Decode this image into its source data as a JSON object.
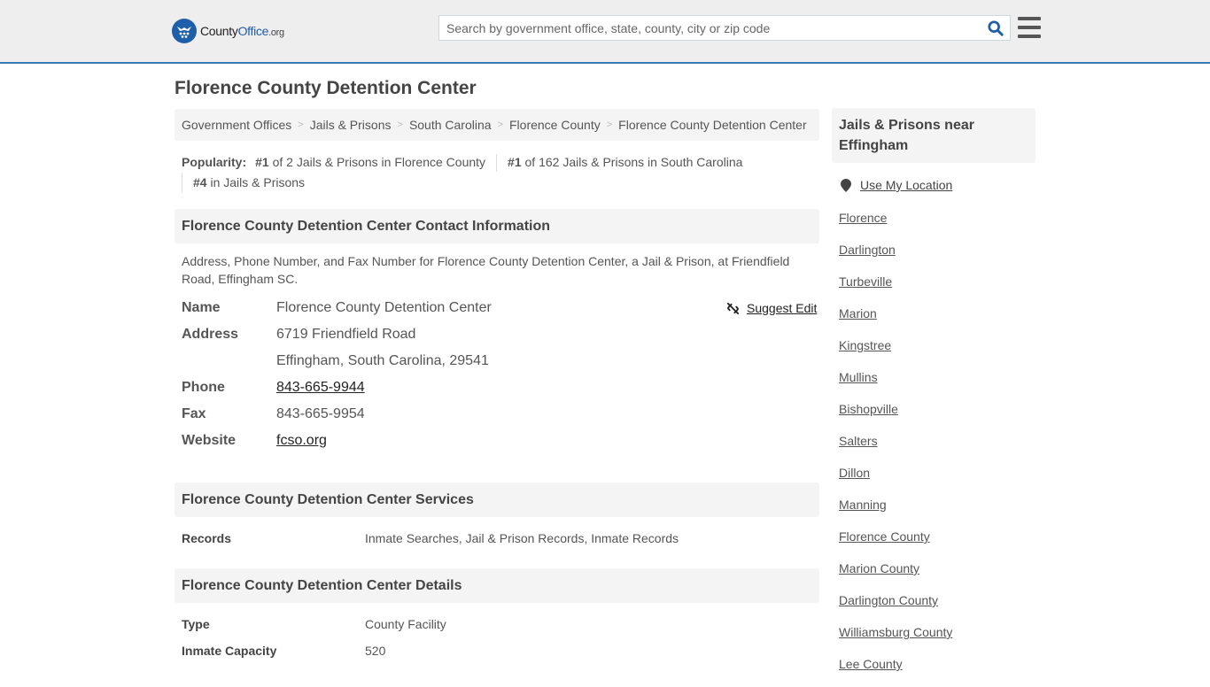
{
  "header": {
    "logo": {
      "part1": "County",
      "part2": "Office",
      "part3": ".org"
    },
    "search": {
      "placeholder": "Search by government office, state, county, city or zip code",
      "value": ""
    },
    "icons": {
      "search": "search-icon",
      "menu": "hamburger-menu-icon"
    }
  },
  "page": {
    "title": "Florence County Detention Center"
  },
  "breadcrumb": [
    "Government Offices",
    "Jails & Prisons",
    "South Carolina",
    "Florence County",
    "Florence County Detention Center"
  ],
  "popularity": {
    "label": "Popularity:",
    "items": [
      {
        "rank": "#1",
        "text": "of 2 Jails & Prisons in Florence County"
      },
      {
        "rank": "#1",
        "text": "of 162 Jails & Prisons in South Carolina"
      },
      {
        "rank": "#4",
        "text": "in Jails & Prisons"
      }
    ]
  },
  "contact": {
    "heading": "Florence County Detention Center Contact Information",
    "description": "Address, Phone Number, and Fax Number for Florence County Detention Center, a Jail & Prison, at Friendfield Road, Effingham SC.",
    "suggest_edit": "Suggest Edit",
    "rows": {
      "name": {
        "label": "Name",
        "value": "Florence County Detention Center"
      },
      "address": {
        "label": "Address",
        "line1": "6719 Friendfield Road",
        "line2": "Effingham, South Carolina, 29541"
      },
      "phone": {
        "label": "Phone",
        "value": "843-665-9944"
      },
      "fax": {
        "label": "Fax",
        "value": "843-665-9954"
      },
      "website": {
        "label": "Website",
        "value": "fcso.org"
      }
    }
  },
  "services": {
    "heading": "Florence County Detention Center Services",
    "rows": [
      {
        "label": "Records",
        "value": "Inmate Searches, Jail & Prison Records, Inmate Records"
      }
    ]
  },
  "details": {
    "heading": "Florence County Detention Center Details",
    "rows": [
      {
        "label": "Type",
        "value": "County Facility"
      },
      {
        "label": "Inmate Capacity",
        "value": "520"
      }
    ]
  },
  "sidebar": {
    "heading": "Jails & Prisons near Effingham",
    "use_location": "Use My Location",
    "links": [
      "Florence",
      "Darlington",
      "Turbeville",
      "Marion",
      "Kingstree",
      "Mullins",
      "Bishopville",
      "Salters",
      "Dillon",
      "Manning",
      "Florence County",
      "Marion County",
      "Darlington County",
      "Williamsburg County",
      "Lee County"
    ]
  },
  "colors": {
    "brand_blue": "#1f5ea8",
    "header_border": "#3a7ab3",
    "panel_bg": "#f4f4f4"
  }
}
